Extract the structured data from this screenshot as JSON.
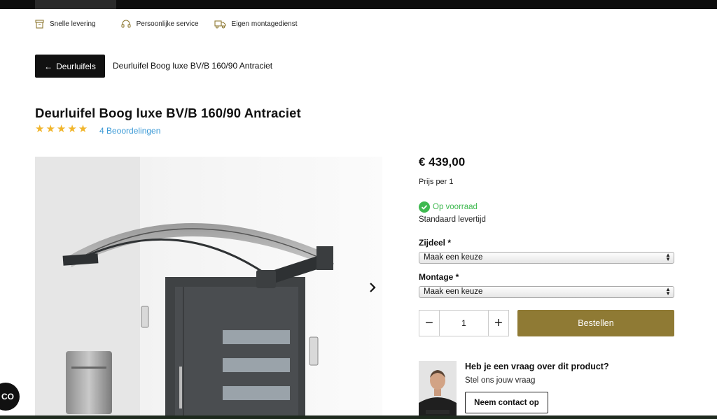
{
  "usps": [
    {
      "icon": "box-icon",
      "label": "Snelle levering"
    },
    {
      "icon": "headset-icon",
      "label": "Persoonlijke service"
    },
    {
      "icon": "truck-icon",
      "label": "Eigen montagedienst"
    }
  ],
  "breadcrumb": {
    "back_label": "Deurluifels",
    "current": "Deurluifel Boog luxe BV/B 160/90 Antraciet"
  },
  "product": {
    "title": "Deurluifel Boog luxe BV/B 160/90 Antraciet",
    "rating": 5,
    "stars": "★★★★★",
    "reviews_label": "4 Beoordelingen",
    "price": "€ 439,00",
    "price_per": "Prijs per 1",
    "stock": "Op voorraad",
    "lead_time": "Standaard levertijd",
    "stock_color": "#3fb950"
  },
  "options": {
    "side_label": "Zijdeel *",
    "side_value": "Maak een keuze",
    "mount_label": "Montage *",
    "mount_value": "Maak een keuze"
  },
  "cart": {
    "quantity": "1",
    "minus": "−",
    "plus": "+",
    "order_label": "Bestellen",
    "order_color": "#8f7a34"
  },
  "help": {
    "question": "Heb je een vraag over dit product?",
    "subtitle": "Stel ons jouw vraag",
    "contact_label": "Neem contact op"
  },
  "chat": {
    "label": "CO"
  }
}
